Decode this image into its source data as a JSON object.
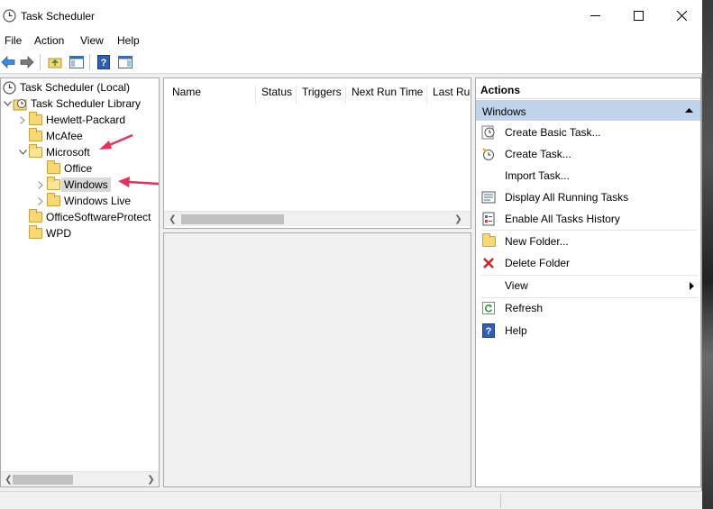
{
  "window": {
    "title": "Task Scheduler"
  },
  "menu": [
    "File",
    "Action",
    "View",
    "Help"
  ],
  "tree": {
    "root": "Task Scheduler (Local)",
    "library": "Task Scheduler Library",
    "folders": [
      "Hewlett-Packard",
      "McAfee",
      "Microsoft",
      "Office",
      "Windows",
      "Windows Live",
      "OfficeSoftwareProtect",
      "WPD"
    ]
  },
  "table": {
    "columns": [
      "Name",
      "Status",
      "Triggers",
      "Next Run Time",
      "Last Ru"
    ]
  },
  "actions": {
    "header": "Actions",
    "section": "Windows",
    "items": [
      {
        "label": "Create Basic Task...",
        "icon": "create-basic-task-icon"
      },
      {
        "label": "Create Task...",
        "icon": "create-task-icon"
      },
      {
        "label": "Import Task...",
        "icon": "none"
      },
      {
        "label": "Display All Running Tasks",
        "icon": "running-tasks-icon"
      },
      {
        "label": "Enable All Tasks History",
        "icon": "history-icon"
      },
      {
        "label": "New Folder...",
        "icon": "new-folder-icon"
      },
      {
        "label": "Delete Folder",
        "icon": "delete-icon"
      },
      {
        "label": "View",
        "icon": "none"
      },
      {
        "label": "Refresh",
        "icon": "refresh-icon"
      },
      {
        "label": "Help",
        "icon": "help-icon"
      }
    ]
  },
  "colors": {
    "selection": "#bfd3ea",
    "annotation_arrow": "#e8305f",
    "folder": "#f8d775"
  }
}
